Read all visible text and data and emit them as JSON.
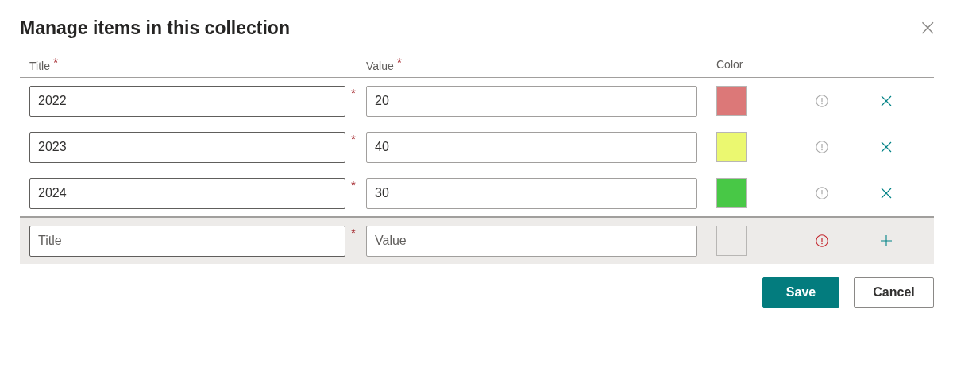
{
  "dialog": {
    "title": "Manage items in this collection",
    "close_label": "×"
  },
  "columns": [
    {
      "label": "Title",
      "required_mark": "*"
    },
    {
      "label": "Value",
      "required_mark": "*"
    },
    {
      "label": "Color"
    }
  ],
  "rows": [
    {
      "kind": "item",
      "title": "2022",
      "title_mark": "*",
      "value": "20",
      "color": "#dc7878",
      "error": false
    },
    {
      "kind": "item",
      "title": "2023",
      "title_mark": "*",
      "value": "40",
      "color": "#ebf870",
      "error": false
    },
    {
      "kind": "item",
      "title": "2024",
      "title_mark": "*",
      "value": "30",
      "color": "#48c846",
      "error": false
    },
    {
      "kind": "new",
      "title_placeholder": "Title",
      "title_mark": "*",
      "value_placeholder": "Value",
      "color": "#edebe9",
      "error": true
    }
  ],
  "buttons": [
    {
      "label": "Save",
      "kind": "primary"
    },
    {
      "label": "Cancel",
      "kind": "secondary"
    }
  ]
}
